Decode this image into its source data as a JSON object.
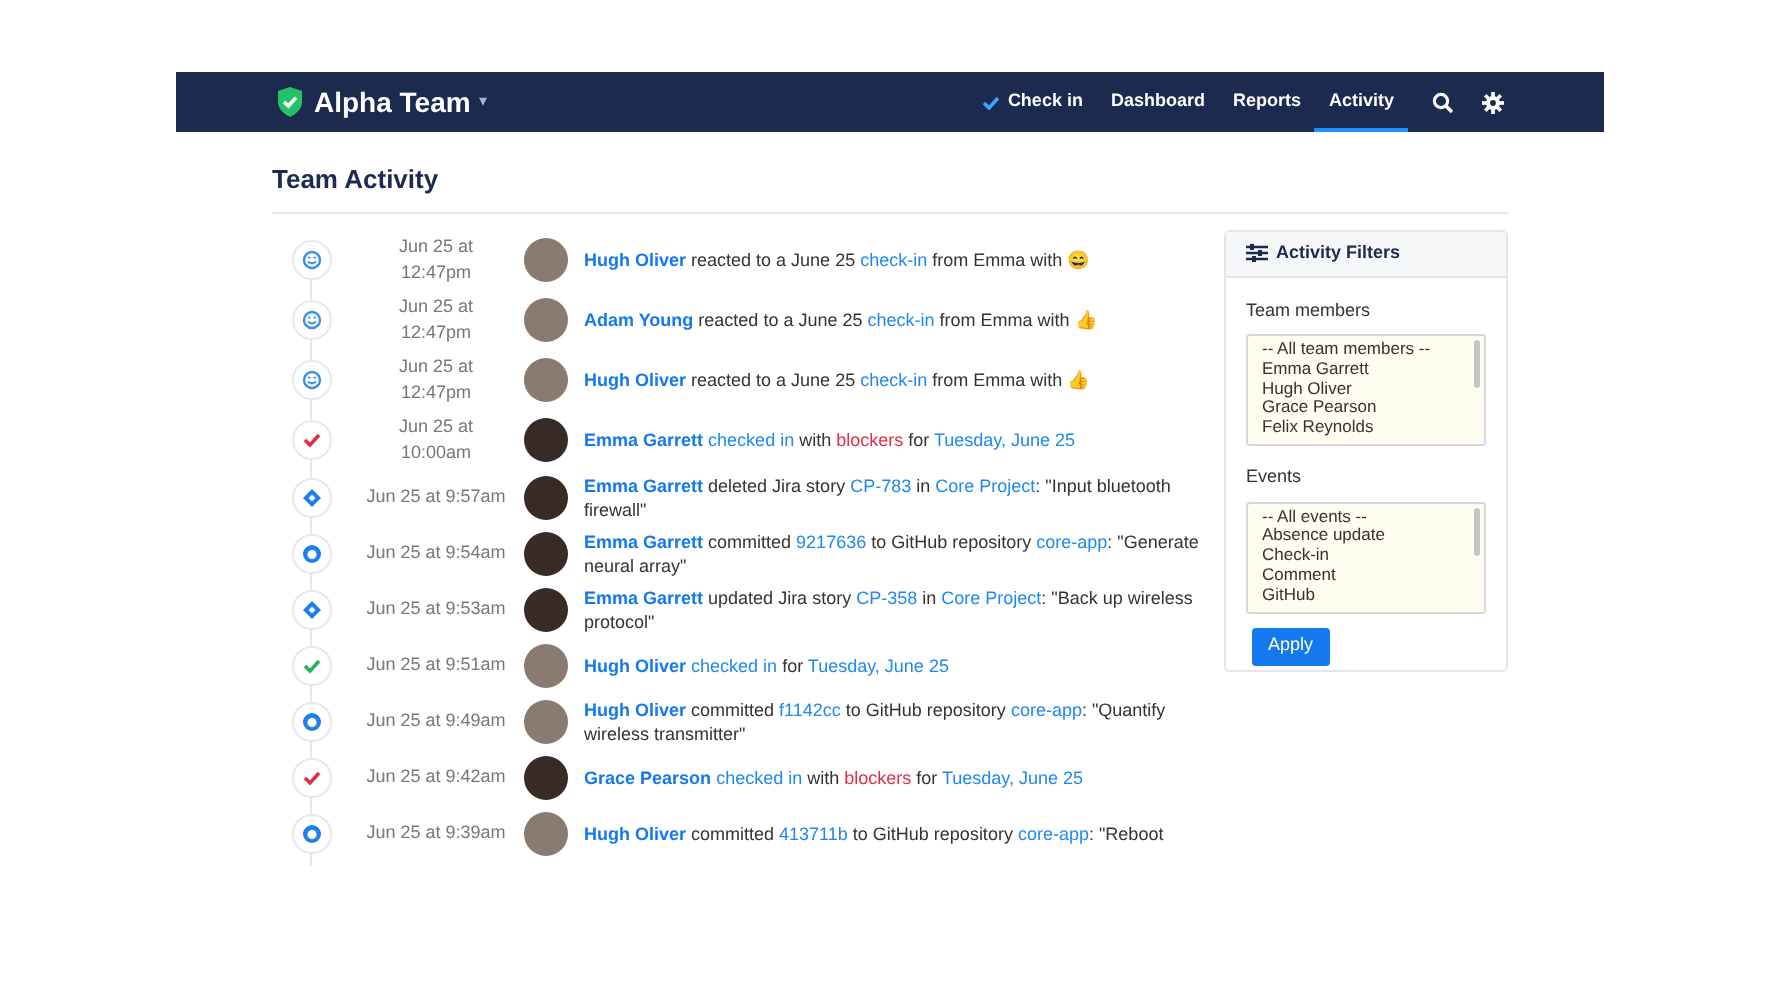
{
  "navbar": {
    "brand": "Alpha Team",
    "caret": "▾",
    "links": [
      {
        "label": "Check in",
        "kind": "checkin",
        "selected": false
      },
      {
        "label": "Dashboard",
        "kind": "plain",
        "selected": false
      },
      {
        "label": "Reports",
        "kind": "plain",
        "selected": false
      },
      {
        "label": "Activity",
        "kind": "plain",
        "selected": true
      }
    ]
  },
  "page_title": "Team Activity",
  "activities": [
    {
      "kind": "reaction",
      "time": "Jun 25 at 12:47pm",
      "parts": [
        {
          "text": "Hugh Oliver",
          "kind": "name"
        },
        {
          "text": " reacted to a June 25 ",
          "kind": "plain"
        },
        {
          "text": "check-in",
          "kind": "link"
        },
        {
          "text": " from Emma with ",
          "kind": "plain"
        },
        {
          "text": "😄",
          "kind": "emoji"
        }
      ]
    },
    {
      "kind": "reaction",
      "time": "Jun 25 at 12:47pm",
      "parts": [
        {
          "text": "Adam Young",
          "kind": "name"
        },
        {
          "text": " reacted to a June 25 ",
          "kind": "plain"
        },
        {
          "text": "check-in",
          "kind": "link"
        },
        {
          "text": " from Emma with ",
          "kind": "plain"
        },
        {
          "text": "👍",
          "kind": "emoji"
        }
      ]
    },
    {
      "kind": "reaction",
      "time": "Jun 25 at 12:47pm",
      "parts": [
        {
          "text": "Hugh Oliver",
          "kind": "name"
        },
        {
          "text": " reacted to a June 25 ",
          "kind": "plain"
        },
        {
          "text": "check-in",
          "kind": "link"
        },
        {
          "text": " from Emma with ",
          "kind": "plain"
        },
        {
          "text": "👍",
          "kind": "emoji"
        }
      ]
    },
    {
      "kind": "blocker",
      "time": "Jun 25 at 10:00am",
      "parts": [
        {
          "text": "Emma Garrett",
          "kind": "name"
        },
        {
          "text": "checked in",
          "kind": "link"
        },
        {
          "text": " with ",
          "kind": "plain"
        },
        {
          "text": "blockers",
          "kind": "danger"
        },
        {
          "text": " for ",
          "kind": "plain"
        },
        {
          "text": "Tuesday, June 25",
          "kind": "link"
        }
      ]
    },
    {
      "kind": "jira",
      "time": "Jun 25 at 9:57am",
      "parts": [
        {
          "text": "Emma Garrett",
          "kind": "name"
        },
        {
          "text": " deleted Jira story ",
          "kind": "plain"
        },
        {
          "text": "CP-783",
          "kind": "link"
        },
        {
          "text": " in ",
          "kind": "plain"
        },
        {
          "text": "Core Project",
          "kind": "link"
        },
        {
          "text": ": \"Input bluetooth firewall\"",
          "kind": "plain"
        }
      ]
    },
    {
      "kind": "github",
      "time": "Jun 25 at 9:54am",
      "parts": [
        {
          "text": "Emma Garrett",
          "kind": "name"
        },
        {
          "text": " committed ",
          "kind": "plain"
        },
        {
          "text": "9217636",
          "kind": "link"
        },
        {
          "text": " to GitHub repository ",
          "kind": "plain"
        },
        {
          "text": "core-app",
          "kind": "link"
        },
        {
          "text": ": \"Generate neural array\"",
          "kind": "plain"
        }
      ]
    },
    {
      "kind": "jira",
      "time": "Jun 25 at 9:53am",
      "parts": [
        {
          "text": "Emma Garrett",
          "kind": "name"
        },
        {
          "text": " updated Jira story ",
          "kind": "plain"
        },
        {
          "text": "CP-358",
          "kind": "link"
        },
        {
          "text": " in ",
          "kind": "plain"
        },
        {
          "text": "Core Project",
          "kind": "link"
        },
        {
          "text": ": \"Back up wireless protocol\"",
          "kind": "plain"
        }
      ]
    },
    {
      "kind": "checkin",
      "time": "Jun 25 at 9:51am",
      "parts": [
        {
          "text": "Hugh Oliver",
          "kind": "name"
        },
        {
          "text": "checked in",
          "kind": "link"
        },
        {
          "text": " for ",
          "kind": "plain"
        },
        {
          "text": "Tuesday, June 25",
          "kind": "link"
        }
      ]
    },
    {
      "kind": "github",
      "time": "Jun 25 at 9:49am",
      "parts": [
        {
          "text": "Hugh Oliver",
          "kind": "name"
        },
        {
          "text": " committed ",
          "kind": "plain"
        },
        {
          "text": "f1142cc",
          "kind": "link"
        },
        {
          "text": " to GitHub repository ",
          "kind": "plain"
        },
        {
          "text": "core-app",
          "kind": "link"
        },
        {
          "text": ": \"Quantify wireless transmitter\"",
          "kind": "plain"
        }
      ]
    },
    {
      "kind": "blocker",
      "time": "Jun 25 at 9:42am",
      "parts": [
        {
          "text": "Grace Pearson",
          "kind": "name"
        },
        {
          "text": "checked in",
          "kind": "link"
        },
        {
          "text": " with ",
          "kind": "plain"
        },
        {
          "text": "blockers",
          "kind": "danger"
        },
        {
          "text": " for ",
          "kind": "plain"
        },
        {
          "text": "Tuesday, June 25",
          "kind": "link"
        }
      ]
    },
    {
      "kind": "github",
      "time": "Jun 25 at 9:39am",
      "parts": [
        {
          "text": "Hugh Oliver",
          "kind": "name"
        },
        {
          "text": " committed ",
          "kind": "plain"
        },
        {
          "text": "413711b",
          "kind": "link"
        },
        {
          "text": " to GitHub repository ",
          "kind": "plain"
        },
        {
          "text": "core-app",
          "kind": "link"
        },
        {
          "text": ": \"Reboot",
          "kind": "plain"
        }
      ]
    }
  ],
  "filters": {
    "title": "Activity Filters",
    "groups": [
      {
        "label": "Team members",
        "options": [
          "-- All team members --",
          "Emma Garrett",
          "Hugh Oliver",
          "Grace Pearson",
          "Felix Reynolds"
        ]
      },
      {
        "label": "Events",
        "options": [
          "-- All events --",
          "Absence update",
          "Check-in",
          "Comment",
          "GitHub"
        ]
      }
    ],
    "button": "Apply"
  }
}
